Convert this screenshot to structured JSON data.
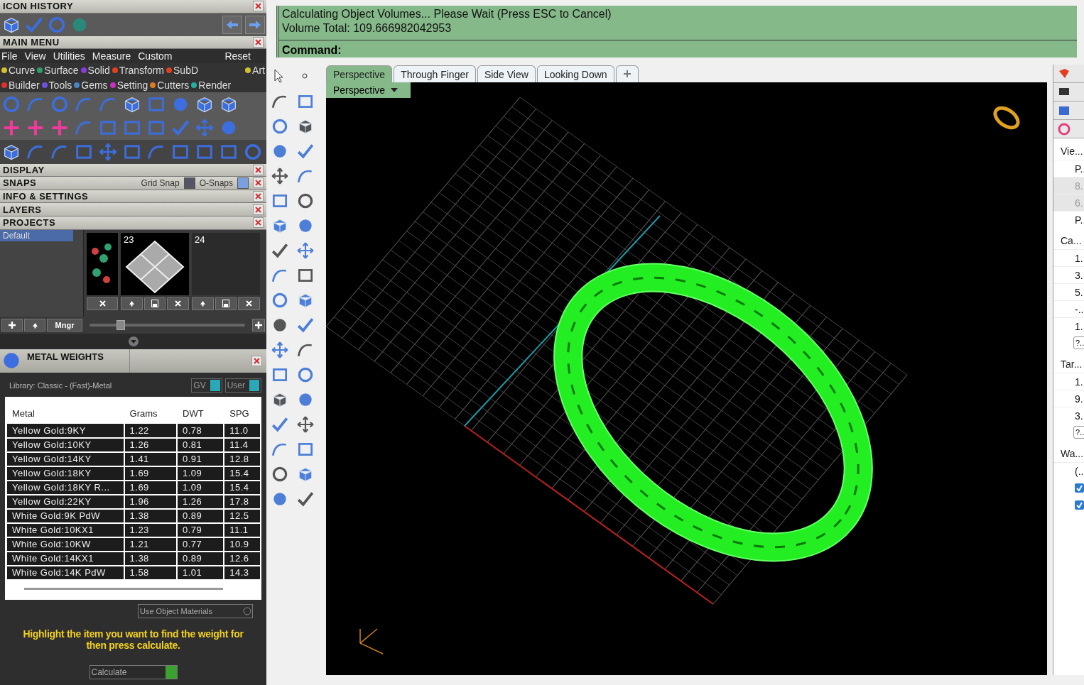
{
  "icon_history": {
    "title": "ICON HISTORY"
  },
  "main_menu": {
    "title": "MAIN MENU",
    "menu": [
      "File",
      "View",
      "Utilities",
      "Measure",
      "Custom"
    ],
    "reset": "Reset",
    "categories": [
      [
        {
          "label": "Curve",
          "color": "#d2c033"
        },
        {
          "label": "Surface",
          "color": "#2e9e6e"
        },
        {
          "label": "Solid",
          "color": "#8a3ad8"
        },
        {
          "label": "Transform",
          "color": "#e0401e"
        },
        {
          "label": "SubD",
          "color": "#e0401e"
        },
        {
          "label": "Art",
          "color": "#d2c033"
        }
      ],
      [
        {
          "label": "Builder",
          "color": "#e03030"
        },
        {
          "label": "Tools",
          "color": "#7050e0"
        },
        {
          "label": "Gems",
          "color": "#4a84c0"
        },
        {
          "label": "Setting",
          "color": "#c830c0"
        },
        {
          "label": "Cutters",
          "color": "#e07a20"
        },
        {
          "label": "Render",
          "color": "#20b0a0"
        }
      ]
    ]
  },
  "panels": [
    {
      "title": "DISPLAY"
    },
    {
      "title": "SNAPS",
      "snaps": [
        {
          "label": "Grid Snap",
          "on": false
        },
        {
          "label": "O-Snaps",
          "on": true
        }
      ]
    },
    {
      "title": "INFO & SETTINGS"
    },
    {
      "title": "LAYERS"
    },
    {
      "title": "PROJECTS"
    }
  ],
  "projects": {
    "list": [
      {
        "label": "Default",
        "selected": true
      }
    ],
    "thumbnails": [
      {
        "kind": "foliage"
      },
      {
        "kind": "plane",
        "number": "23"
      },
      {
        "kind": "empty",
        "number": "24"
      }
    ],
    "manager": "Mngr",
    "slider": {
      "level": 0.2
    }
  },
  "metal_weights": {
    "title": "METAL WEIGHTS",
    "library": "Library: Classic - (Fast)-Metal",
    "toggles": [
      {
        "label": "GV",
        "on": true
      },
      {
        "label": "User",
        "on": true
      }
    ],
    "columns": [
      "Metal",
      "Grams",
      "DWT",
      "SPG"
    ],
    "rows": [
      [
        "Yellow Gold:9KY",
        "1.22",
        "0.78",
        "11.0"
      ],
      [
        "Yellow Gold:10KY",
        "1.26",
        "0.81",
        "11.4"
      ],
      [
        "Yellow Gold:14KY",
        "1.41",
        "0.91",
        "12.8"
      ],
      [
        "Yellow Gold:18KY",
        "1.69",
        "1.09",
        "15.4"
      ],
      [
        "Yellow Gold:18KY R...",
        "1.69",
        "1.09",
        "15.4"
      ],
      [
        "Yellow Gold:22KY",
        "1.96",
        "1.26",
        "17.8"
      ],
      [
        "White Gold:9K PdW",
        "1.38",
        "0.89",
        "12.5"
      ],
      [
        "White Gold:10KX1",
        "1.23",
        "0.79",
        "11.1"
      ],
      [
        "White Gold:10KW",
        "1.21",
        "0.77",
        "10.9"
      ],
      [
        "White Gold:14KX1",
        "1.38",
        "0.89",
        "12.6"
      ],
      [
        "White Gold:14K PdW",
        "1.58",
        "1.01",
        "14.3"
      ]
    ],
    "use_object_materials": {
      "label": "Use Object Materials",
      "checked": false
    },
    "hint": "Highlight the item you want to find the weight for then press calculate.",
    "calculate": "Calculate"
  },
  "command": {
    "lines": [
      "Calculating Object Volumes... Please Wait (Press ESC to Cancel)",
      "Volume Total: 109.666982042953"
    ],
    "prompt": "Command:"
  },
  "tabs": [
    {
      "label": "Perspective",
      "selected": true
    },
    {
      "label": "Through Finger",
      "selected": false
    },
    {
      "label": "Side View",
      "selected": false
    },
    {
      "label": "Looking Down",
      "selected": false
    }
  ],
  "viewport": {
    "label": "Perspective"
  },
  "properties": [
    {
      "kind": "header",
      "text": "Vie..."
    },
    {
      "kind": "value",
      "text": "P..",
      "disabled": false
    },
    {
      "kind": "value",
      "text": "8..",
      "disabled": true
    },
    {
      "kind": "value",
      "text": "6..",
      "disabled": true
    },
    {
      "kind": "value",
      "text": "P..",
      "disabled": false
    },
    {
      "kind": "header",
      "text": "Ca..."
    },
    {
      "kind": "value",
      "text": "1..",
      "disabled": false
    },
    {
      "kind": "value",
      "text": "3..",
      "disabled": false
    },
    {
      "kind": "value",
      "text": "5..",
      "disabled": false
    },
    {
      "kind": "value",
      "text": "-..",
      "disabled": false
    },
    {
      "kind": "value",
      "text": "1..",
      "disabled": false
    },
    {
      "kind": "button",
      "text": "?.."
    },
    {
      "kind": "header",
      "text": "Tar..."
    },
    {
      "kind": "value",
      "text": "1..",
      "disabled": false
    },
    {
      "kind": "value",
      "text": "9..",
      "disabled": false
    },
    {
      "kind": "value",
      "text": "3..",
      "disabled": false
    },
    {
      "kind": "button",
      "text": "?.."
    },
    {
      "kind": "header",
      "text": "Wa..."
    },
    {
      "kind": "value",
      "text": "(..",
      "disabled": false
    },
    {
      "kind": "checkbox",
      "checked": true
    },
    {
      "kind": "checkbox",
      "checked": true
    }
  ]
}
